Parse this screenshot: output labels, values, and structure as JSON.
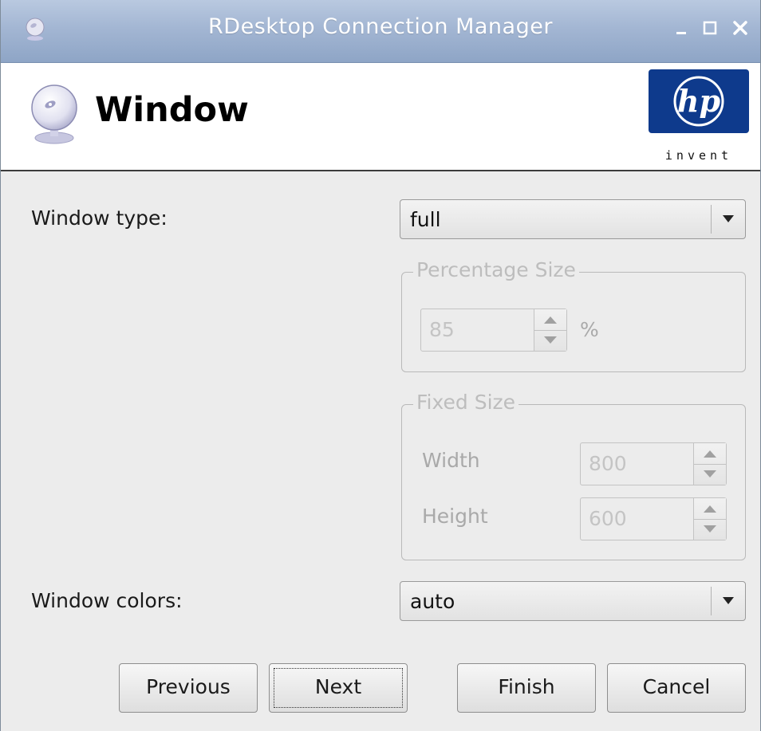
{
  "window": {
    "title": "RDesktop Connection Manager",
    "controls": [
      "minimize",
      "maximize",
      "close"
    ]
  },
  "header": {
    "title": "Window",
    "logo_text": "invent",
    "logo_mark": "hp"
  },
  "form": {
    "window_type": {
      "label": "Window type:",
      "value": "full"
    },
    "percentage_size": {
      "legend": "Percentage Size",
      "value": "85",
      "unit": "%",
      "enabled": false
    },
    "fixed_size": {
      "legend": "Fixed Size",
      "width_label": "Width",
      "width_value": "800",
      "height_label": "Height",
      "height_value": "600",
      "enabled": false
    },
    "window_colors": {
      "label": "Window colors:",
      "value": "auto"
    }
  },
  "buttons": {
    "previous": "Previous",
    "next": "Next",
    "finish": "Finish",
    "cancel": "Cancel",
    "focused": "next"
  },
  "colors": {
    "titlebar": "#a3b6d3",
    "hp_blue": "#0e3a8c",
    "disabled_text": "#a9a9a9"
  }
}
